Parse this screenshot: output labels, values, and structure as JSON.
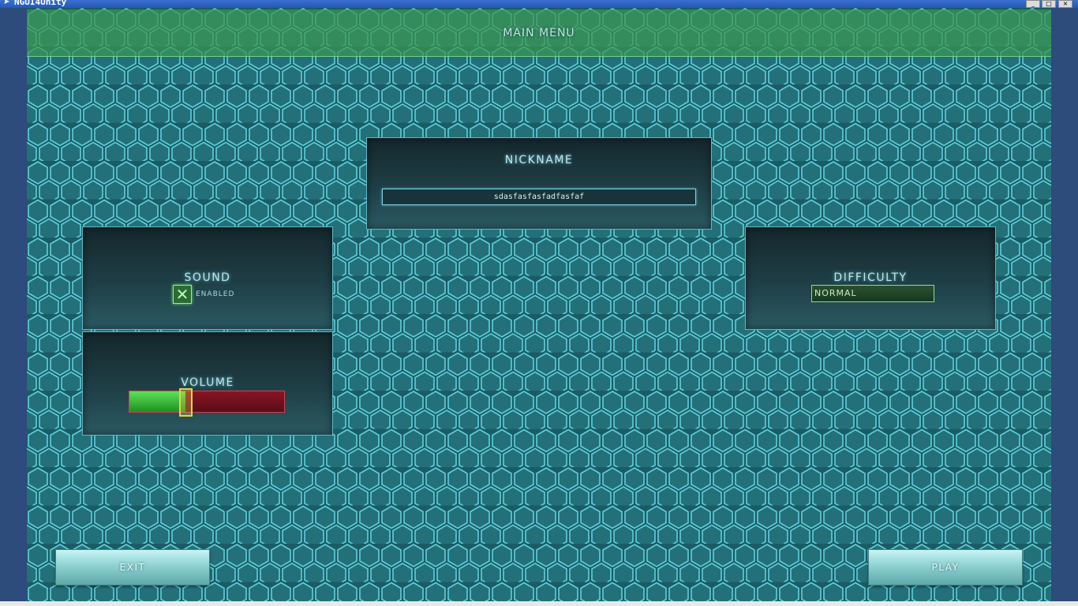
{
  "window": {
    "title": "NGUI4Unity",
    "minimize": "_",
    "maximize": "□",
    "close": "×"
  },
  "header": {
    "title": "MAIN MENU"
  },
  "nickname": {
    "label": "NICKNAME",
    "value": "sdasfasfasfadfasfaf"
  },
  "sound": {
    "label": "SOUND",
    "checkbox_label": "ENABLED",
    "checked": true,
    "check_glyph": "✕"
  },
  "volume": {
    "label": "VOLUME",
    "level": 0.36
  },
  "difficulty": {
    "label": "DIFFICULTY",
    "selected": "NORMAL"
  },
  "buttons": {
    "exit": "EXIT",
    "play": "PLAY"
  },
  "colors": {
    "background": "#1e6a72",
    "header_bar": "#3c9650",
    "volume_on": "#3cc83c",
    "volume_off": "#8a1424",
    "thumb": "#e2d24a"
  }
}
